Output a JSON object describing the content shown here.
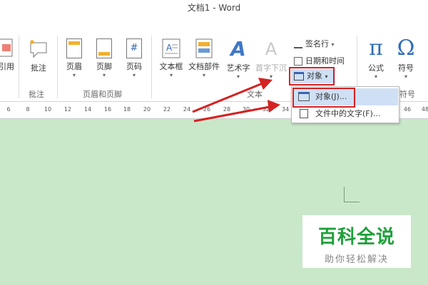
{
  "window": {
    "title": "文档1 - Word"
  },
  "ribbon": {
    "groups": {
      "comments": "批注",
      "header_footer": "页眉和页脚",
      "text": "文本",
      "symbols": "符号"
    },
    "buttons": {
      "cross_ref": "引用",
      "comment": "批注",
      "header": "页眉",
      "footer": "页脚",
      "page_number": "页码",
      "page_number_glyph": "#",
      "textbox": "文本框",
      "quick_parts": "文档部件",
      "wordart": "艺术字",
      "wordart_glyph": "A",
      "dropcap": "首字下沉",
      "dropcap_glyph": "A",
      "equation": "公式",
      "equation_glyph": "π",
      "symbol": "符号",
      "symbol_glyph": "Ω"
    },
    "text_small": {
      "signature_line": "签名行",
      "date_time": "日期和时间",
      "object": "对象"
    }
  },
  "ruler": {
    "ticks": [
      "6",
      "8",
      "10",
      "12",
      "14",
      "16",
      "18",
      "20",
      "22",
      "24",
      "26",
      "28",
      "30",
      "32",
      "34",
      "46",
      "48"
    ]
  },
  "object_menu": {
    "items": [
      {
        "label": "对象(J)..."
      },
      {
        "label": "文件中的文字(F)..."
      }
    ]
  },
  "watermark": {
    "title": "百科全说",
    "subtitle": "助你轻松解决"
  },
  "colors": {
    "document_bg": "#c9e8c9",
    "highlight_red": "#d42222",
    "watermark_green": "#1ea03a",
    "menu_selected": "#cfe0f5"
  }
}
